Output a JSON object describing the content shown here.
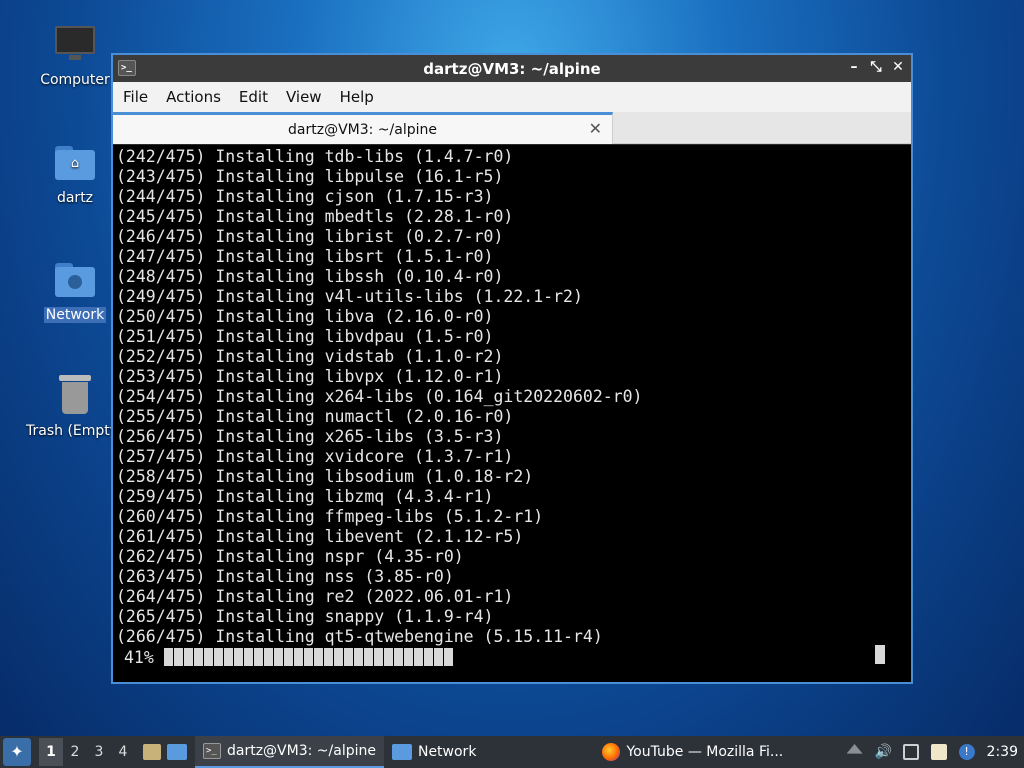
{
  "desktop": {
    "icons": [
      {
        "label": "Computer"
      },
      {
        "label": "dartz"
      },
      {
        "label": "Network"
      },
      {
        "label": "Trash (Empty)"
      }
    ]
  },
  "window": {
    "title": "dartz@VM3: ~/alpine",
    "menu": [
      "File",
      "Actions",
      "Edit",
      "View",
      "Help"
    ],
    "tab_title": "dartz@VM3: ~/alpine",
    "controls": {
      "minimize": "–",
      "maximize": "⤡",
      "close": "✕"
    }
  },
  "terminal": {
    "lines": [
      "(242/475) Installing tdb-libs (1.4.7-r0)",
      "(243/475) Installing libpulse (16.1-r5)",
      "(244/475) Installing cjson (1.7.15-r3)",
      "(245/475) Installing mbedtls (2.28.1-r0)",
      "(246/475) Installing librist (0.2.7-r0)",
      "(247/475) Installing libsrt (1.5.1-r0)",
      "(248/475) Installing libssh (0.10.4-r0)",
      "(249/475) Installing v4l-utils-libs (1.22.1-r2)",
      "(250/475) Installing libva (2.16.0-r0)",
      "(251/475) Installing libvdpau (1.5-r0)",
      "(252/475) Installing vidstab (1.1.0-r2)",
      "(253/475) Installing libvpx (1.12.0-r1)",
      "(254/475) Installing x264-libs (0.164_git20220602-r0)",
      "(255/475) Installing numactl (2.0.16-r0)",
      "(256/475) Installing x265-libs (3.5-r3)",
      "(257/475) Installing xvidcore (1.3.7-r1)",
      "(258/475) Installing libsodium (1.0.18-r2)",
      "(259/475) Installing libzmq (4.3.4-r1)",
      "(260/475) Installing ffmpeg-libs (5.1.2-r1)",
      "(261/475) Installing libevent (2.1.12-r5)",
      "(262/475) Installing nspr (4.35-r0)",
      "(263/475) Installing nss (3.85-r0)",
      "(264/475) Installing re2 (2022.06.01-r1)",
      "(265/475) Installing snappy (1.1.9-r4)",
      "(266/475) Installing qt5-qtwebengine (5.15.11-r4)"
    ],
    "progress_label": "41%",
    "progress_fraction": 0.41
  },
  "taskbar": {
    "workspaces": [
      "1",
      "2",
      "3",
      "4"
    ],
    "tasks": [
      {
        "label": "dartz@VM3: ~/alpine"
      },
      {
        "label": "Network"
      },
      {
        "label": "YouTube — Mozilla Fi..."
      }
    ],
    "clock": "2:39"
  }
}
